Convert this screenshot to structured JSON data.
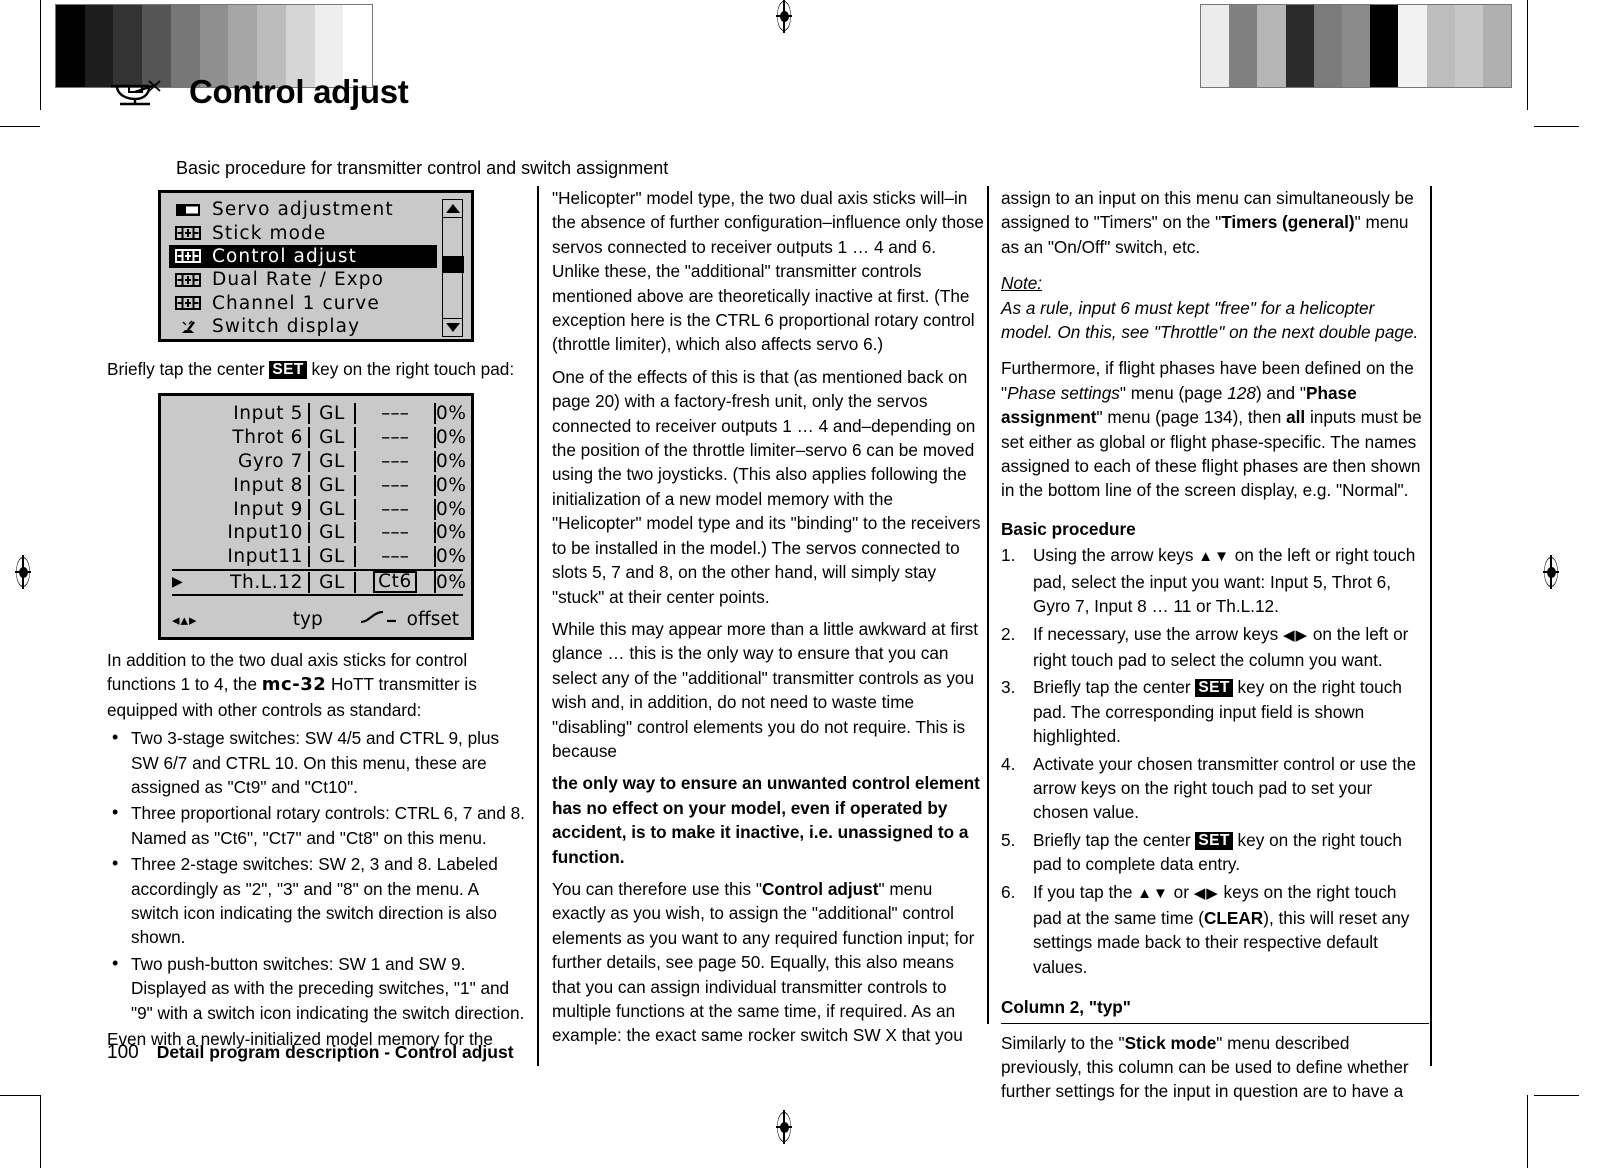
{
  "header": {
    "icon": "helicopter-icon",
    "title": "Control adjust",
    "subtitle": "Basic procedure for transmitter control and switch assignment"
  },
  "lcd_menu": {
    "name": "menu-screen",
    "items": [
      {
        "icon": "servo-icon",
        "label": "Servo adjustment",
        "selected": false
      },
      {
        "icon": "stick-icon",
        "label": "Stick mode",
        "selected": false
      },
      {
        "icon": "control-icon",
        "label": "Control adjust",
        "selected": true
      },
      {
        "icon": "dualrate-icon",
        "label": "Dual Rate / Expo",
        "selected": false
      },
      {
        "icon": "curve-icon",
        "label": "Channel 1 curve",
        "selected": false
      },
      {
        "icon": "switch-icon",
        "label": "Switch display",
        "selected": false
      }
    ],
    "scroll_up": "▲",
    "scroll_down": "▼"
  },
  "caption_set": {
    "pre": "Briefly tap the center ",
    "key": "SET",
    "post": " key on the right touch pad:"
  },
  "lcd_table": {
    "name": "control-adjust-table",
    "rows": [
      {
        "marker": "",
        "input": "Input  5",
        "typ": "GL",
        "src": "–––",
        "value": "0%",
        "boxed": false,
        "selected": false
      },
      {
        "marker": "",
        "input": "Throt  6",
        "typ": "GL",
        "src": "–––",
        "value": "0%",
        "boxed": false,
        "selected": false
      },
      {
        "marker": "",
        "input": "Gyro   7",
        "typ": "GL",
        "src": "–––",
        "value": "0%",
        "boxed": false,
        "selected": false
      },
      {
        "marker": "",
        "input": "Input  8",
        "typ": "GL",
        "src": "–––",
        "value": "0%",
        "boxed": false,
        "selected": false
      },
      {
        "marker": "",
        "input": "Input  9",
        "typ": "GL",
        "src": "–––",
        "value": "0%",
        "boxed": false,
        "selected": false
      },
      {
        "marker": "",
        "input": "Input10",
        "typ": "GL",
        "src": "–––",
        "value": "0%",
        "boxed": false,
        "selected": false
      },
      {
        "marker": "",
        "input": "Input11",
        "typ": "GL",
        "src": "–––",
        "value": "0%",
        "boxed": false,
        "selected": false
      },
      {
        "marker": "▶",
        "input": "Th.L.12",
        "typ": "GL",
        "src": "Ct6",
        "value": "0%",
        "boxed": true,
        "selected": true
      }
    ],
    "footer": {
      "nav": "◂▴▸",
      "typ": "typ",
      "curve": "curve-icon",
      "offset": "offset"
    }
  },
  "col1": {
    "p1_a": "In addition to the two dual axis sticks for control functions 1 to 4, the ",
    "p1_b": "mc-32",
    "p1_c": " HoTT transmitter is equipped with other controls as standard:",
    "bullets": [
      "Two 3-stage switches: SW 4/5 and CTRL 9, plus SW 6/7 and CTRL 10. On this menu, these are assigned as \"Ct9\" and \"Ct10\".",
      "Three proportional rotary controls: CTRL 6, 7 and 8. Named as \"Ct6\", \"Ct7\" and \"Ct8\" on this menu.",
      "Three 2-stage switches: SW 2, 3 and 8. Labeled accordingly as \"2\", \"3\" and \"8\" on the menu. A switch icon indicating the switch direction is also shown.",
      "Two push-button switches: SW 1 and SW 9. Displayed as with the preceding switches, \"1\" and \"9\" with a switch icon indicating the switch direction."
    ],
    "p2": "Even with a newly-initialized model memory for the"
  },
  "col2": {
    "p1": "\"Helicopter\" model type, the two dual axis sticks will–in the absence of further configuration–influence only those servos connected to receiver outputs 1 … 4 and 6. Unlike these, the \"additional\" transmitter controls mentioned above are theoretically inactive at first. (The exception here is the CTRL 6 proportional rotary control (throttle limiter), which also affects servo 6.)",
    "p2": "One of the effects of this is that (as mentioned back on page 20) with a factory-fresh unit, only the servos connected to receiver outputs 1 … 4 and–depending on the position of the throttle limiter–servo 6 can be moved using the two joysticks. (This also applies following the initialization of a new model memory with the \"Helicopter\" model type and its \"binding\" to the receivers to be installed in the model.)   The servos connected to slots 5, 7 and 8, on the other hand, will simply stay \"stuck\" at their center points.",
    "p3": "While this may appear more than a little awkward at first glance … this is the only way to ensure that you can select any of the \"additional\" transmitter controls as you wish and, in addition, do not need to waste time \"disabling\" control elements you do not require. This is because",
    "p4_bold": "the only way to ensure an unwanted control element has no effect on your model, even if operated by accident, is to make it inactive, i.e. unassigned to a function.",
    "p5_a": "You can therefore use this \"",
    "p5_b": "Control adjust",
    "p5_c": "\" menu exactly as you wish, to assign the \"additional\" control elements as you want to any required function input; for further details, see page 50. Equally, this also means that you can assign individual transmitter controls to multiple functions at the same time, if required.  As an example: the exact same rocker switch SW X that you"
  },
  "col3": {
    "p1_a": "assign to an input on this menu can simultaneously be assigned to \"Timers\" on the \"",
    "p1_b": "Timers (general)",
    "p1_c": "\" menu as an \"On/Off\" switch, etc.",
    "note_label": "Note:",
    "note_text": "As a rule, input 6 must kept \"free\" for a helicopter model. On this, see \"Throttle\" on the next double page.",
    "p2_a": "Furthermore, if flight phases have been defined on the \"",
    "p2_b": "Phase settings",
    "p2_c": "\" menu (page ",
    "p2_d": "128",
    "p2_e": ") and \"",
    "p2_f": "Phase assignment",
    "p2_g": "\" menu (page 134), then ",
    "p2_h": "all",
    "p2_i": " inputs must be set either as global or flight phase-specific. The names assigned to each of these flight phases are then shown in the bottom line of the screen display, e.g. \"Normal\".",
    "basic_heading": "Basic procedure",
    "steps": [
      {
        "parts": [
          "Using the arrow keys ",
          "▲▼",
          " on the left or right touch pad, select the input you want: Input 5, Throt 6, Gyro 7, Input 8 … 11 or Th.L.12."
        ]
      },
      {
        "parts": [
          "If necessary, use the arrow keys ",
          "◀▶",
          " on the left or right touch pad to select the column you want."
        ]
      },
      {
        "parts": [
          "Briefly tap the center ",
          "SET",
          " key on the right touch pad. The corresponding input field is shown highlighted."
        ]
      },
      {
        "parts": [
          "Activate your chosen transmitter control or use the arrow keys on the right touch pad to set your chosen value."
        ]
      },
      {
        "parts": [
          "Briefly tap the center ",
          "SET",
          " key on the right touch pad to complete data entry."
        ]
      },
      {
        "parts": [
          "If you tap the ",
          "▲▼",
          " or ",
          "◀▶",
          " keys on the right touch pad at the same time (",
          "CLEAR",
          "), this will reset any settings made back to their respective default values."
        ]
      }
    ],
    "column2_heading": "Column 2, \"typ\"",
    "p3_a": "Similarly to the \"",
    "p3_b": "Stick mode",
    "p3_c": "\" menu described previously, this column can be used to define whether further settings for the input in question are to have a"
  },
  "footer": {
    "page_number": "100",
    "title": "Detail program description - Control adjust"
  },
  "colors": {
    "lcd_background": "#c9c9c9",
    "ink": "#000000",
    "paper": "#ffffff"
  },
  "print_marks": {
    "left_gradient": [
      "#000000",
      "#1d1d1d",
      "#333333",
      "#555555",
      "#777777",
      "#8f8f8f",
      "#a6a6a6",
      "#bcbcbc",
      "#d5d5d5",
      "#eeeeee",
      "#ffffff"
    ],
    "right_gradient": [
      "#ececec",
      "#808080",
      "#b6b6b6",
      "#2b2b2b",
      "#7b7b7b",
      "#8a8a8a",
      "#000000",
      "#f2f2f2",
      "#bdbdbd",
      "#c7c7c7",
      "#b0b0b0"
    ]
  }
}
